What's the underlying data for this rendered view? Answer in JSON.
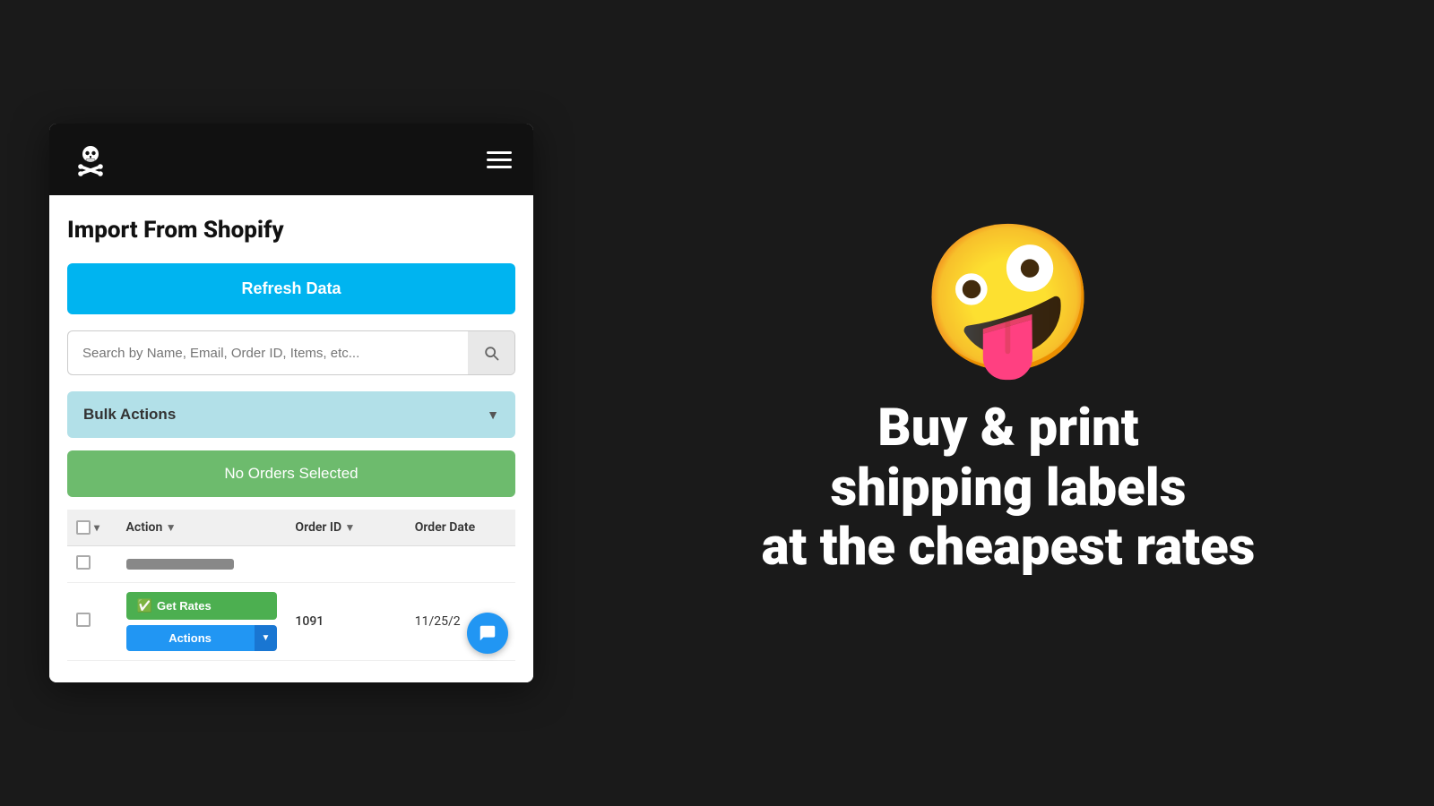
{
  "app": {
    "header": {
      "logo_alt": "Pirate Ship Logo",
      "menu_label": "Menu"
    },
    "page_title": "Import From Shopify",
    "refresh_btn": "Refresh Data",
    "search": {
      "placeholder": "Search by Name, Email, Order ID, Items, etc...",
      "btn_label": "Search"
    },
    "bulk_actions": {
      "label": "Bulk Actions",
      "chevron": "▼"
    },
    "no_orders_btn": "No Orders Selected",
    "table": {
      "columns": [
        "",
        "Action",
        "Order ID",
        "Order Date"
      ],
      "filter_icon": "▼",
      "rows": [
        {
          "loading": true
        },
        {
          "loading": false,
          "action_get_rates": "Get Rates",
          "action_actions": "Actions",
          "order_id": "1091",
          "order_date": "11/25/2"
        }
      ]
    },
    "chat_icon": "💬"
  },
  "promo": {
    "emoji": "🤪",
    "line1": "Buy & print",
    "line2": "shipping labels",
    "line3": "at the cheapest rates"
  }
}
